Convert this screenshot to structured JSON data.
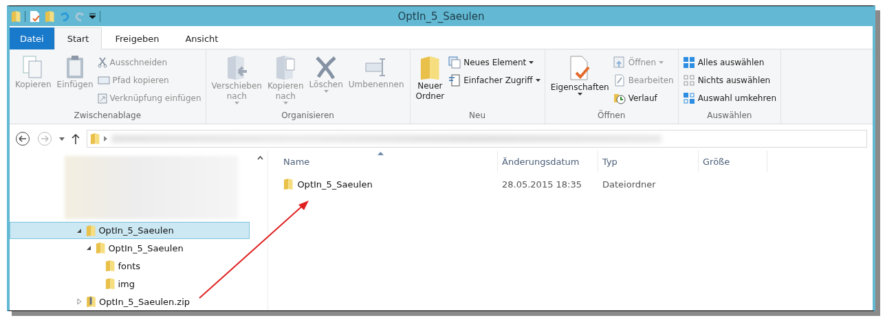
{
  "window": {
    "title": "OptIn_5_Saeulen"
  },
  "tabs": [
    {
      "label": "Datei",
      "kind": "file",
      "selected": false
    },
    {
      "label": "Start",
      "kind": "tab",
      "selected": true
    },
    {
      "label": "Freigeben",
      "kind": "tab",
      "selected": false
    },
    {
      "label": "Ansicht",
      "kind": "tab",
      "selected": false
    }
  ],
  "ribbon": {
    "groups": [
      {
        "label": "Zwischenablage",
        "items": [
          {
            "label": "Kopieren",
            "kind": "large",
            "disabled": true,
            "dropdown": false
          },
          {
            "label": "Einfügen",
            "kind": "large",
            "disabled": true,
            "dropdown": false
          },
          {
            "kind": "stack",
            "items": [
              {
                "label": "Ausschneiden",
                "disabled": true,
                "dropdown": false
              },
              {
                "label": "Pfad kopieren",
                "disabled": true,
                "dropdown": false
              },
              {
                "label": "Verknüpfung einfügen",
                "disabled": true,
                "dropdown": false
              }
            ]
          }
        ]
      },
      {
        "label": "Organisieren",
        "items": [
          {
            "label": "Verschieben\nnach",
            "kind": "large",
            "disabled": true,
            "dropdown": true
          },
          {
            "label": "Kopieren\nnach",
            "kind": "large",
            "disabled": true,
            "dropdown": true
          },
          {
            "label": "Löschen",
            "kind": "large",
            "disabled": true,
            "dropdown": true
          },
          {
            "label": "Umbenennen",
            "kind": "large",
            "disabled": true,
            "dropdown": false
          }
        ]
      },
      {
        "label": "Neu",
        "items": [
          {
            "label": "Neuer\nOrdner",
            "kind": "large",
            "disabled": false,
            "dropdown": false
          },
          {
            "kind": "stack",
            "items": [
              {
                "label": "Neues Element",
                "disabled": false,
                "dropdown": true
              },
              {
                "label": "Einfacher Zugriff",
                "disabled": false,
                "dropdown": true
              }
            ]
          }
        ]
      },
      {
        "label": "Öffnen",
        "items": [
          {
            "label": "Eigenschaften",
            "kind": "large",
            "disabled": false,
            "dropdown": true
          },
          {
            "kind": "stack",
            "items": [
              {
                "label": "Öffnen",
                "disabled": true,
                "dropdown": true
              },
              {
                "label": "Bearbeiten",
                "disabled": true,
                "dropdown": false
              },
              {
                "label": "Verlauf",
                "disabled": false,
                "dropdown": false
              }
            ]
          }
        ]
      },
      {
        "label": "Auswählen",
        "items": [
          {
            "kind": "stack",
            "items": [
              {
                "label": "Alles auswählen",
                "disabled": false,
                "dropdown": false
              },
              {
                "label": "Nichts auswählen",
                "disabled": false,
                "dropdown": false
              },
              {
                "label": "Auswahl umkehren",
                "disabled": false,
                "dropdown": false
              }
            ]
          }
        ]
      }
    ]
  },
  "navigation": {
    "back_enabled": true,
    "forward_enabled": false
  },
  "tree": [
    {
      "label": "OptIn_5_Saeulen",
      "kind": "folder",
      "selected": true,
      "expanded": true,
      "children": [
        {
          "label": "OptIn_5_Saeulen",
          "kind": "folder",
          "selected": false,
          "expanded": true,
          "children": [
            {
              "label": "fonts",
              "kind": "folder",
              "selected": false
            },
            {
              "label": "img",
              "kind": "folder",
              "selected": false
            }
          ]
        }
      ]
    },
    {
      "label": "OptIn_5_Saeulen.zip",
      "kind": "zip",
      "selected": false,
      "expanded": false
    }
  ],
  "file_list": {
    "columns": [
      {
        "label": "Name",
        "sorted": true
      },
      {
        "label": "Änderungsdatum",
        "sorted": false
      },
      {
        "label": "Typ",
        "sorted": false
      },
      {
        "label": "Größe",
        "sorted": false
      }
    ],
    "rows": [
      {
        "name": "OptIn_5_Saeulen",
        "date": "28.05.2015 18:35",
        "type": "Dateiordner"
      }
    ]
  }
}
